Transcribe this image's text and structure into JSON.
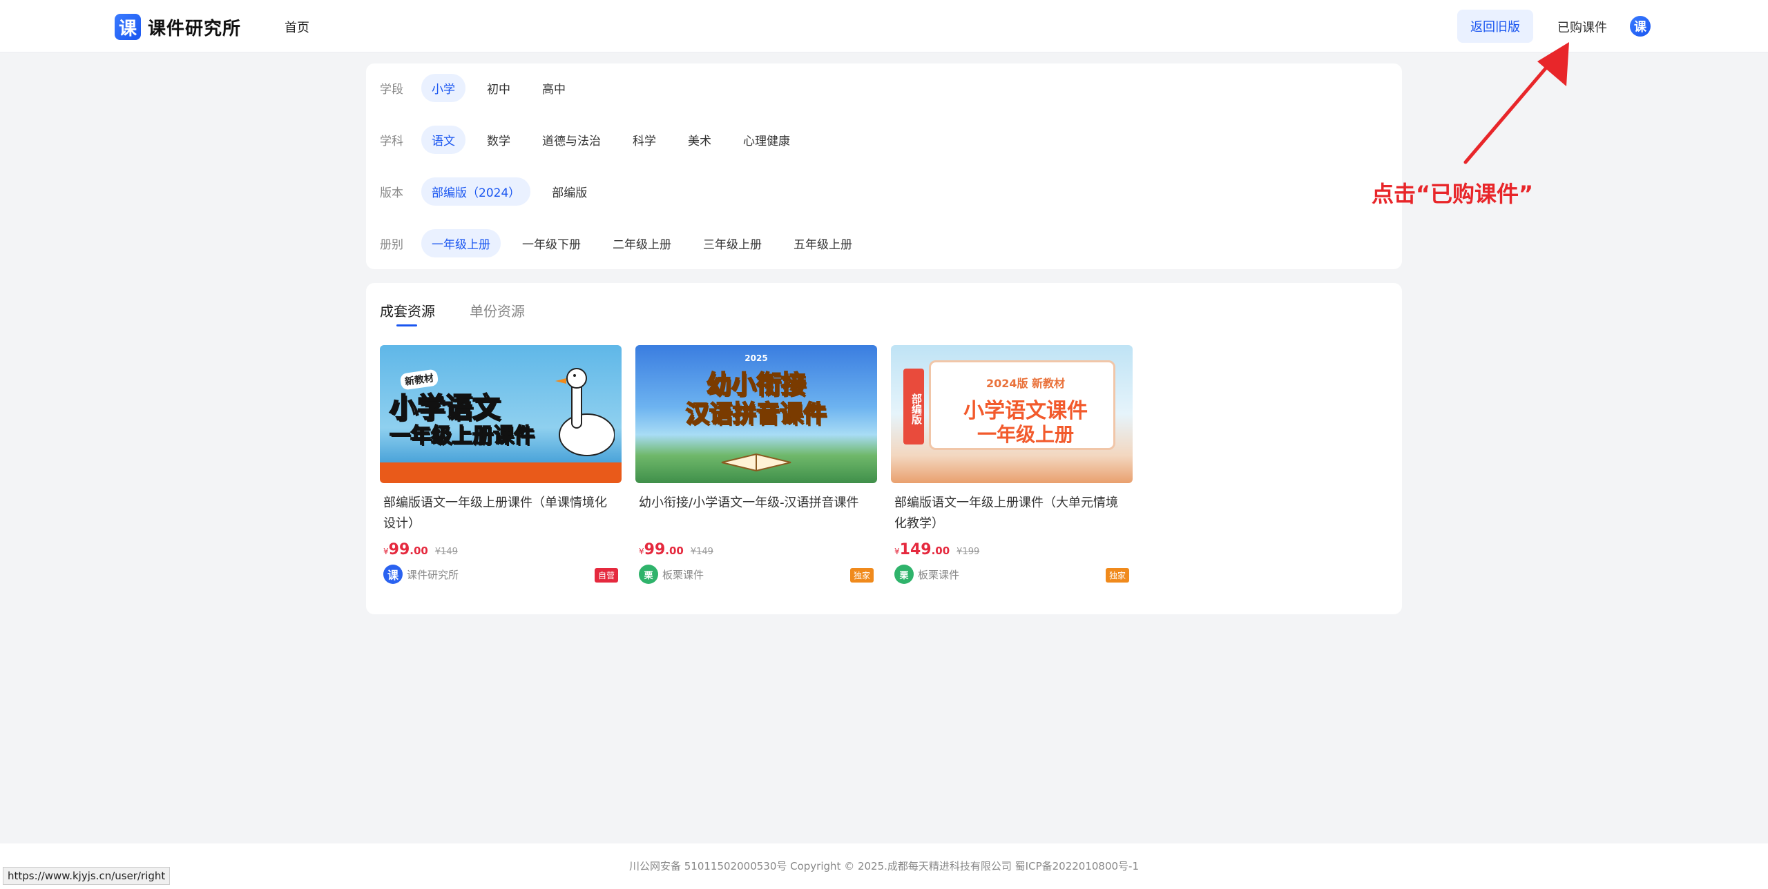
{
  "header": {
    "logo_glyph": "课",
    "logo_text": "课件研究所",
    "nav_home": "首页",
    "btn_old": "返回旧版",
    "btn_bought": "已购课件",
    "avatar_glyph": "课"
  },
  "filters": {
    "stage": {
      "label": "学段",
      "options": [
        "小学",
        "初中",
        "高中"
      ],
      "selected": "小学"
    },
    "subject": {
      "label": "学科",
      "options": [
        "语文",
        "数学",
        "道德与法治",
        "科学",
        "美术",
        "心理健康"
      ],
      "selected": "语文"
    },
    "edition": {
      "label": "版本",
      "options": [
        "部编版（2024）",
        "部编版"
      ],
      "selected": "部编版（2024）"
    },
    "volume": {
      "label": "册别",
      "options": [
        "一年级上册",
        "一年级下册",
        "二年级上册",
        "三年级上册",
        "五年级上册"
      ],
      "selected": "一年级上册"
    }
  },
  "tabs": {
    "set": "成套资源",
    "single": "单份资源",
    "active": "成套资源"
  },
  "courses": [
    {
      "thumb_line1": "小学语文",
      "thumb_line2": "一年级上册课件",
      "thumb_tag": "新教材",
      "title": "部编版语文一年级上册课件（单课情境化设计）",
      "price_symbol": "¥",
      "price_int": "99",
      "price_dec": ".00",
      "orig_price": "¥149",
      "vendor": "课件研究所",
      "vendor_glyph": "课",
      "badge": "自营",
      "badge_color": "#e5293e"
    },
    {
      "thumb_line1": "幼小衔接",
      "thumb_line2": "汉语拼音课件",
      "thumb_tag": "2025",
      "title": "幼小衔接/小学语文一年级-汉语拼音课件",
      "price_symbol": "¥",
      "price_int": "99",
      "price_dec": ".00",
      "orig_price": "¥149",
      "vendor": "板栗课件",
      "vendor_glyph": "栗",
      "badge": "独家",
      "badge_color": "#f08a1c"
    },
    {
      "thumb_line1": "小学语文课件",
      "thumb_line2": "一年级上册",
      "thumb_tag": "2024版 新教材",
      "thumb_side": "部编版",
      "title": "部编版语文一年级上册课件（大单元情境化教学）",
      "price_symbol": "¥",
      "price_int": "149",
      "price_dec": ".00",
      "orig_price": "¥199",
      "vendor": "板栗课件",
      "vendor_glyph": "栗",
      "badge": "独家",
      "badge_color": "#f08a1c"
    }
  ],
  "annotation": {
    "text": "点击“已购课件”"
  },
  "footer": {
    "text": "川公网安备 51011502000530号    Copyright © 2025.成都每天精进科技有限公司    蜀ICP备2022010800号-1"
  },
  "status_bar": {
    "url": "https://www.kjyjs.cn/user/right"
  },
  "colors": {
    "accent": "#1a56f0",
    "price": "#e5293e",
    "annotation": "#e8262a"
  }
}
